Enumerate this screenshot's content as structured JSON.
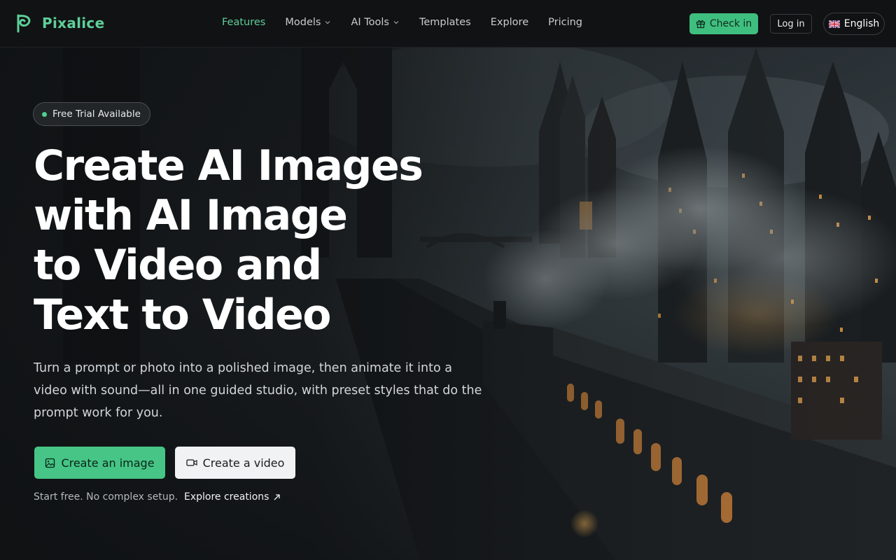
{
  "brand": {
    "name": "Pixalice",
    "color": "#5ecf9a"
  },
  "nav": {
    "items": [
      {
        "label": "Features",
        "active": true,
        "dropdown": false
      },
      {
        "label": "Models",
        "active": false,
        "dropdown": true
      },
      {
        "label": "AI Tools",
        "active": false,
        "dropdown": true
      },
      {
        "label": "Templates",
        "active": false,
        "dropdown": false
      },
      {
        "label": "Explore",
        "active": false,
        "dropdown": false
      },
      {
        "label": "Pricing",
        "active": false,
        "dropdown": false
      }
    ]
  },
  "header_actions": {
    "checkin_label": "Check in",
    "login_label": "Log in",
    "language_label": "English"
  },
  "hero": {
    "badge": "Free Trial Available",
    "headline_lines": [
      "Create AI Images",
      "with AI Image",
      "to Video and",
      "Text to Video"
    ],
    "subtext": "Turn a prompt or photo into a polished image, then animate it into a video with sound—all in one guided studio, with preset styles that do the prompt work for you.",
    "cta_image": "Create an image",
    "cta_video": "Create a video",
    "footnote": "Start free. No complex setup.",
    "explore_link": "Explore creations"
  },
  "colors": {
    "accent": "#46c586",
    "header_bg": "#111213",
    "secondary_button": "#f1f2f3"
  },
  "icons": {
    "logo": "pixalice-p-logo-icon",
    "checkin": "gift-icon",
    "language": "uk-flag-icon",
    "cta_image": "image-icon",
    "cta_video": "video-camera-icon",
    "explore": "arrow-up-right-icon"
  }
}
